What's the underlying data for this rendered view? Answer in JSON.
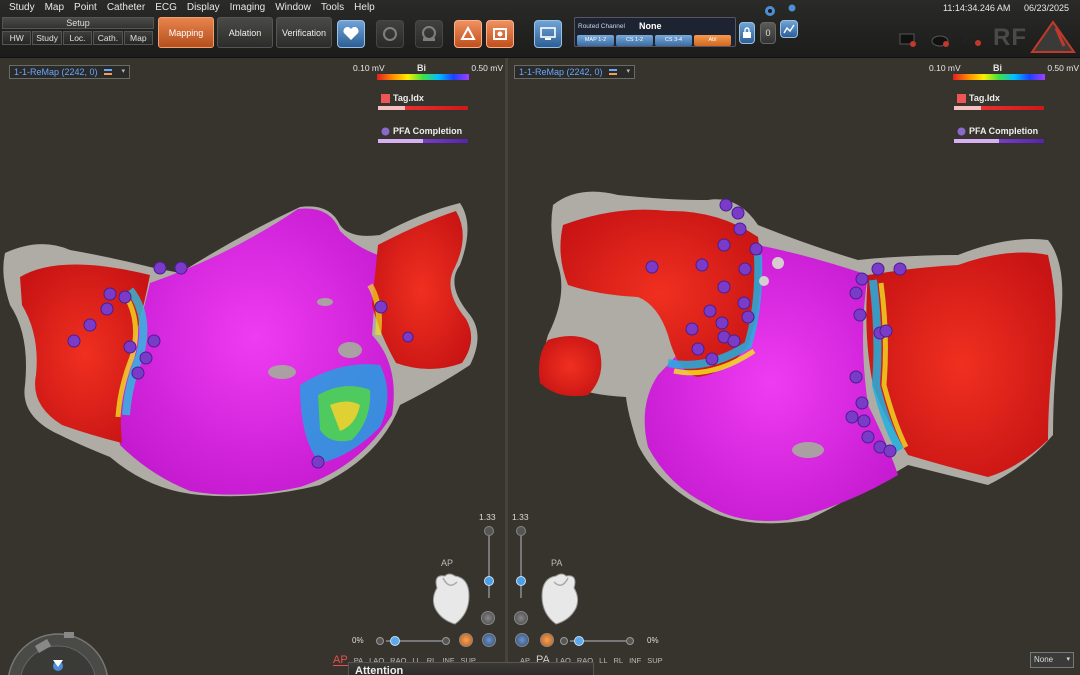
{
  "menu": [
    "Study",
    "Map",
    "Point",
    "Catheter",
    "ECG",
    "Display",
    "Imaging",
    "Window",
    "Tools",
    "Help"
  ],
  "setup": {
    "title": "Setup",
    "tabs": [
      "HW",
      "Study",
      "Loc.",
      "Cath.",
      "Map"
    ]
  },
  "modes": {
    "mapping": "Mapping",
    "ablation": "Ablation",
    "verification": "Verification"
  },
  "toolbar_icons": [
    "heart-plus-icon",
    "reset-icon",
    "auto-icon",
    "triangle-icon",
    "snapshot-icon",
    "monitor-icon"
  ],
  "routed": {
    "label": "Routed Channel",
    "value": "None",
    "chips": [
      "MAP 1-2",
      "CS 1-2",
      "CS 3-4",
      "Abl"
    ]
  },
  "clock": {
    "time": "11:14:34.246 AM",
    "date": "06/23/2025"
  },
  "rf_logo": "RF",
  "left_view": {
    "map_name": "1-1-ReMap (2242, 0)",
    "scale_min": "0.10 mV",
    "scale_label": "Bi",
    "scale_max": "0.50 mV",
    "tag_label": "Tag.Idx",
    "pfa_label": "PFA Completion",
    "zoom": "1.33",
    "orientation": "AP",
    "opacity": "0%"
  },
  "right_view": {
    "map_name": "1-1-ReMap (2242, 0)",
    "scale_min": "0.10 mV",
    "scale_label": "Bi",
    "scale_max": "0.50 mV",
    "tag_label": "Tag.Idx",
    "pfa_label": "PFA Completion",
    "zoom": "1.33",
    "orientation": "PA",
    "opacity": "0%"
  },
  "view_tabs_left": [
    "AP",
    "PA",
    "LAO",
    "RAO",
    "LL",
    "RL",
    "INF",
    "SUP"
  ],
  "view_tabs_right": [
    "AP",
    "PA",
    "LAO",
    "RAO",
    "LL",
    "RL",
    "INF",
    "SUP"
  ],
  "attention": "Attention",
  "bottom_select": "None",
  "colors": {
    "accent_orange": "#e07030",
    "tissue_red": "#e31a1a",
    "tissue_magenta": "#e020e8",
    "tag_purple": "#6a2fc0",
    "link_blue": "#6aa6ff"
  }
}
